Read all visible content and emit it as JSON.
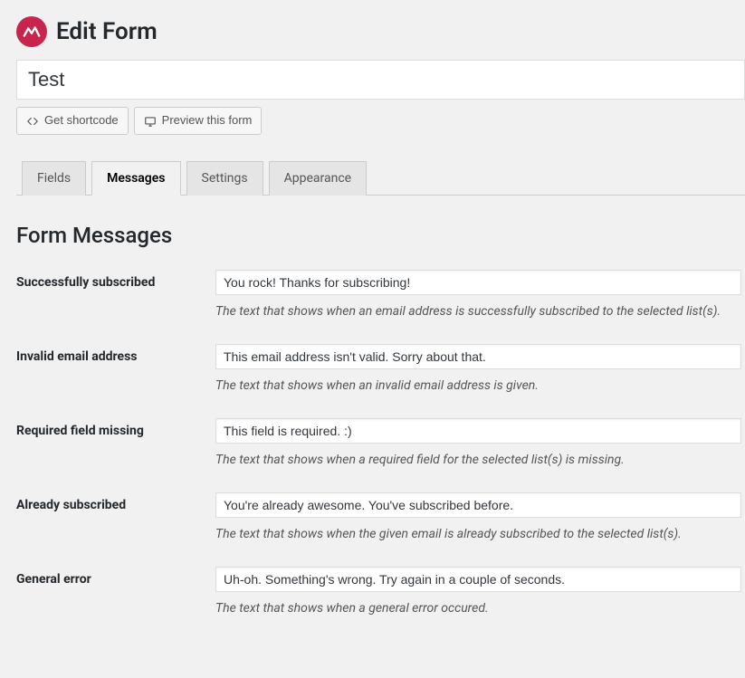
{
  "header": {
    "title": "Edit Form"
  },
  "form": {
    "name": "Test"
  },
  "buttons": {
    "shortcode": "Get shortcode",
    "preview": "Preview this form"
  },
  "tabs": {
    "fields": "Fields",
    "messages": "Messages",
    "settings": "Settings",
    "appearance": "Appearance"
  },
  "section": {
    "title": "Form Messages"
  },
  "rows": {
    "success": {
      "label": "Successfully subscribed",
      "value": "You rock! Thanks for subscribing!",
      "help": "The text that shows when an email address is successfully subscribed to the selected list(s)."
    },
    "invalid": {
      "label": "Invalid email address",
      "value": "This email address isn't valid. Sorry about that.",
      "help": "The text that shows when an invalid email address is given."
    },
    "required": {
      "label": "Required field missing",
      "value": "This field is required. :)",
      "help": "The text that shows when a required field for the selected list(s) is missing."
    },
    "already": {
      "label": "Already subscribed",
      "value": "You're already awesome. You've subscribed before.",
      "help": "The text that shows when the given email is already subscribed to the selected list(s)."
    },
    "error": {
      "label": "General error",
      "value": "Uh-oh. Something's wrong. Try again in a couple of seconds.",
      "help": "The text that shows when a general error occured."
    }
  }
}
